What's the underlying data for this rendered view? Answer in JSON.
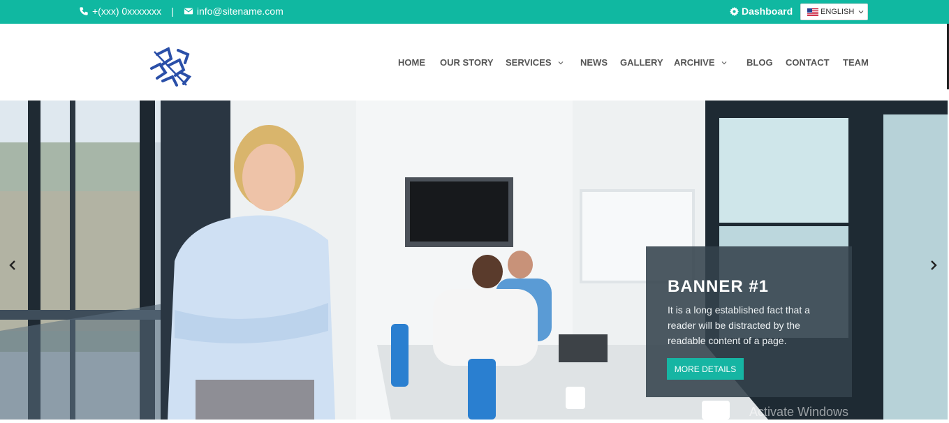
{
  "topbar": {
    "phone": "+(xxx) 0xxxxxxx",
    "separator": "|",
    "email": "info@sitename.com",
    "dashboard": "Dashboard",
    "language": "ENGLISH",
    "bg_color": "#10b8a1"
  },
  "nav": {
    "items": [
      {
        "label": "HOME",
        "dropdown": false
      },
      {
        "label": "OUR STORY",
        "dropdown": false
      },
      {
        "label": "SERVICES",
        "dropdown": true
      },
      {
        "label": "NEWS",
        "dropdown": false
      },
      {
        "label": "GALLERY",
        "dropdown": false
      },
      {
        "label": "ARCHIVE",
        "dropdown": true
      },
      {
        "label": "BLOG",
        "dropdown": false
      },
      {
        "label": "CONTACT",
        "dropdown": false
      },
      {
        "label": "TEAM",
        "dropdown": false
      }
    ]
  },
  "banner": {
    "title": "BANNER #1",
    "description": "It is a long established fact that a reader will be distracted by the readable content of a page.",
    "button": "MORE DETAILS",
    "accent": "#16b5a3"
  },
  "watermark": "Activate Windows",
  "icons": [
    "phone-icon",
    "envelope-icon",
    "gear-icon",
    "us-flag-icon",
    "chevron-down-icon",
    "chevron-left-icon",
    "chevron-right-icon"
  ]
}
